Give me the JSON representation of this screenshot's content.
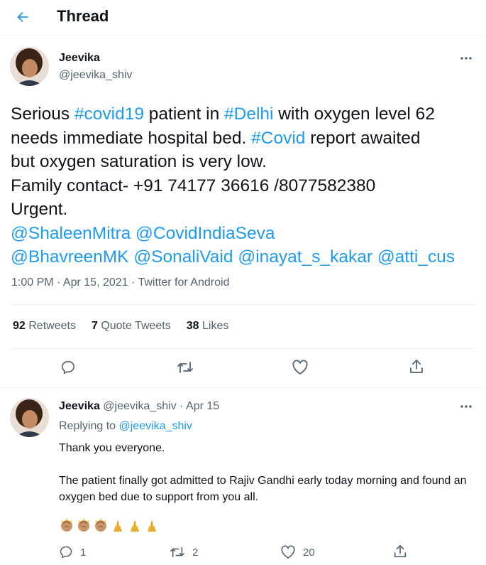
{
  "header": {
    "title": "Thread"
  },
  "tweet": {
    "author_name": "Jeevika",
    "author_handle": "@jeevika_shiv",
    "lines": [
      [
        {
          "t": "Serious "
        },
        {
          "t": "#covid19",
          "link": true
        },
        {
          "t": " patient in "
        },
        {
          "t": "#Delhi",
          "link": true
        },
        {
          "t": " with oxygen level 62"
        }
      ],
      [
        {
          "t": "needs immediate hospital bed. "
        },
        {
          "t": "#Covid",
          "link": true
        },
        {
          "t": " report awaited"
        }
      ],
      [
        {
          "t": "but oxygen saturation is very low."
        }
      ],
      [
        {
          "t": "Family contact- +91 74177 36616 /8077582380"
        }
      ],
      [
        {
          "t": "Urgent."
        }
      ],
      [
        {
          "t": "@ShaleenMitra",
          "link": true
        },
        {
          "t": " "
        },
        {
          "t": "@CovidIndiaSeva",
          "link": true
        }
      ],
      [
        {
          "t": "@BhavreenMK",
          "link": true
        },
        {
          "t": " "
        },
        {
          "t": "@SonaliVaid",
          "link": true
        },
        {
          "t": " "
        },
        {
          "t": "@inayat_s_kakar",
          "link": true
        },
        {
          "t": " "
        },
        {
          "t": "@atti_cus",
          "link": true
        }
      ]
    ],
    "timestamp": "1:00 PM · Apr 15, 2021 · Twitter for Android",
    "stats": {
      "retweets_count": "92",
      "retweets_label": "Retweets",
      "quotes_count": "7",
      "quotes_label": "Quote Tweets",
      "likes_count": "38",
      "likes_label": "Likes"
    }
  },
  "reply": {
    "author_name": "Jeevika",
    "author_handle_date": "@jeevika_shiv · Apr 15",
    "replying_prefix": "Replying to ",
    "replying_to": "@jeevika_shiv",
    "paragraphs": [
      "Thank you everyone.",
      "The patient finally got admitted to Rajiv Gandhi early today morning and found an oxygen bed due to support from you all."
    ],
    "emojis": [
      "clapping-hands-medium-skin-icon",
      "clapping-hands-medium-skin-icon",
      "clapping-hands-medium-skin-icon",
      "folded-hands-icon",
      "folded-hands-icon",
      "folded-hands-icon"
    ],
    "counts": {
      "replies": "1",
      "retweets": "2",
      "likes": "20"
    }
  },
  "colors": {
    "accent": "#1d9bf0",
    "muted": "#536471",
    "text": "#0f1419",
    "divider": "#eff3f4"
  }
}
